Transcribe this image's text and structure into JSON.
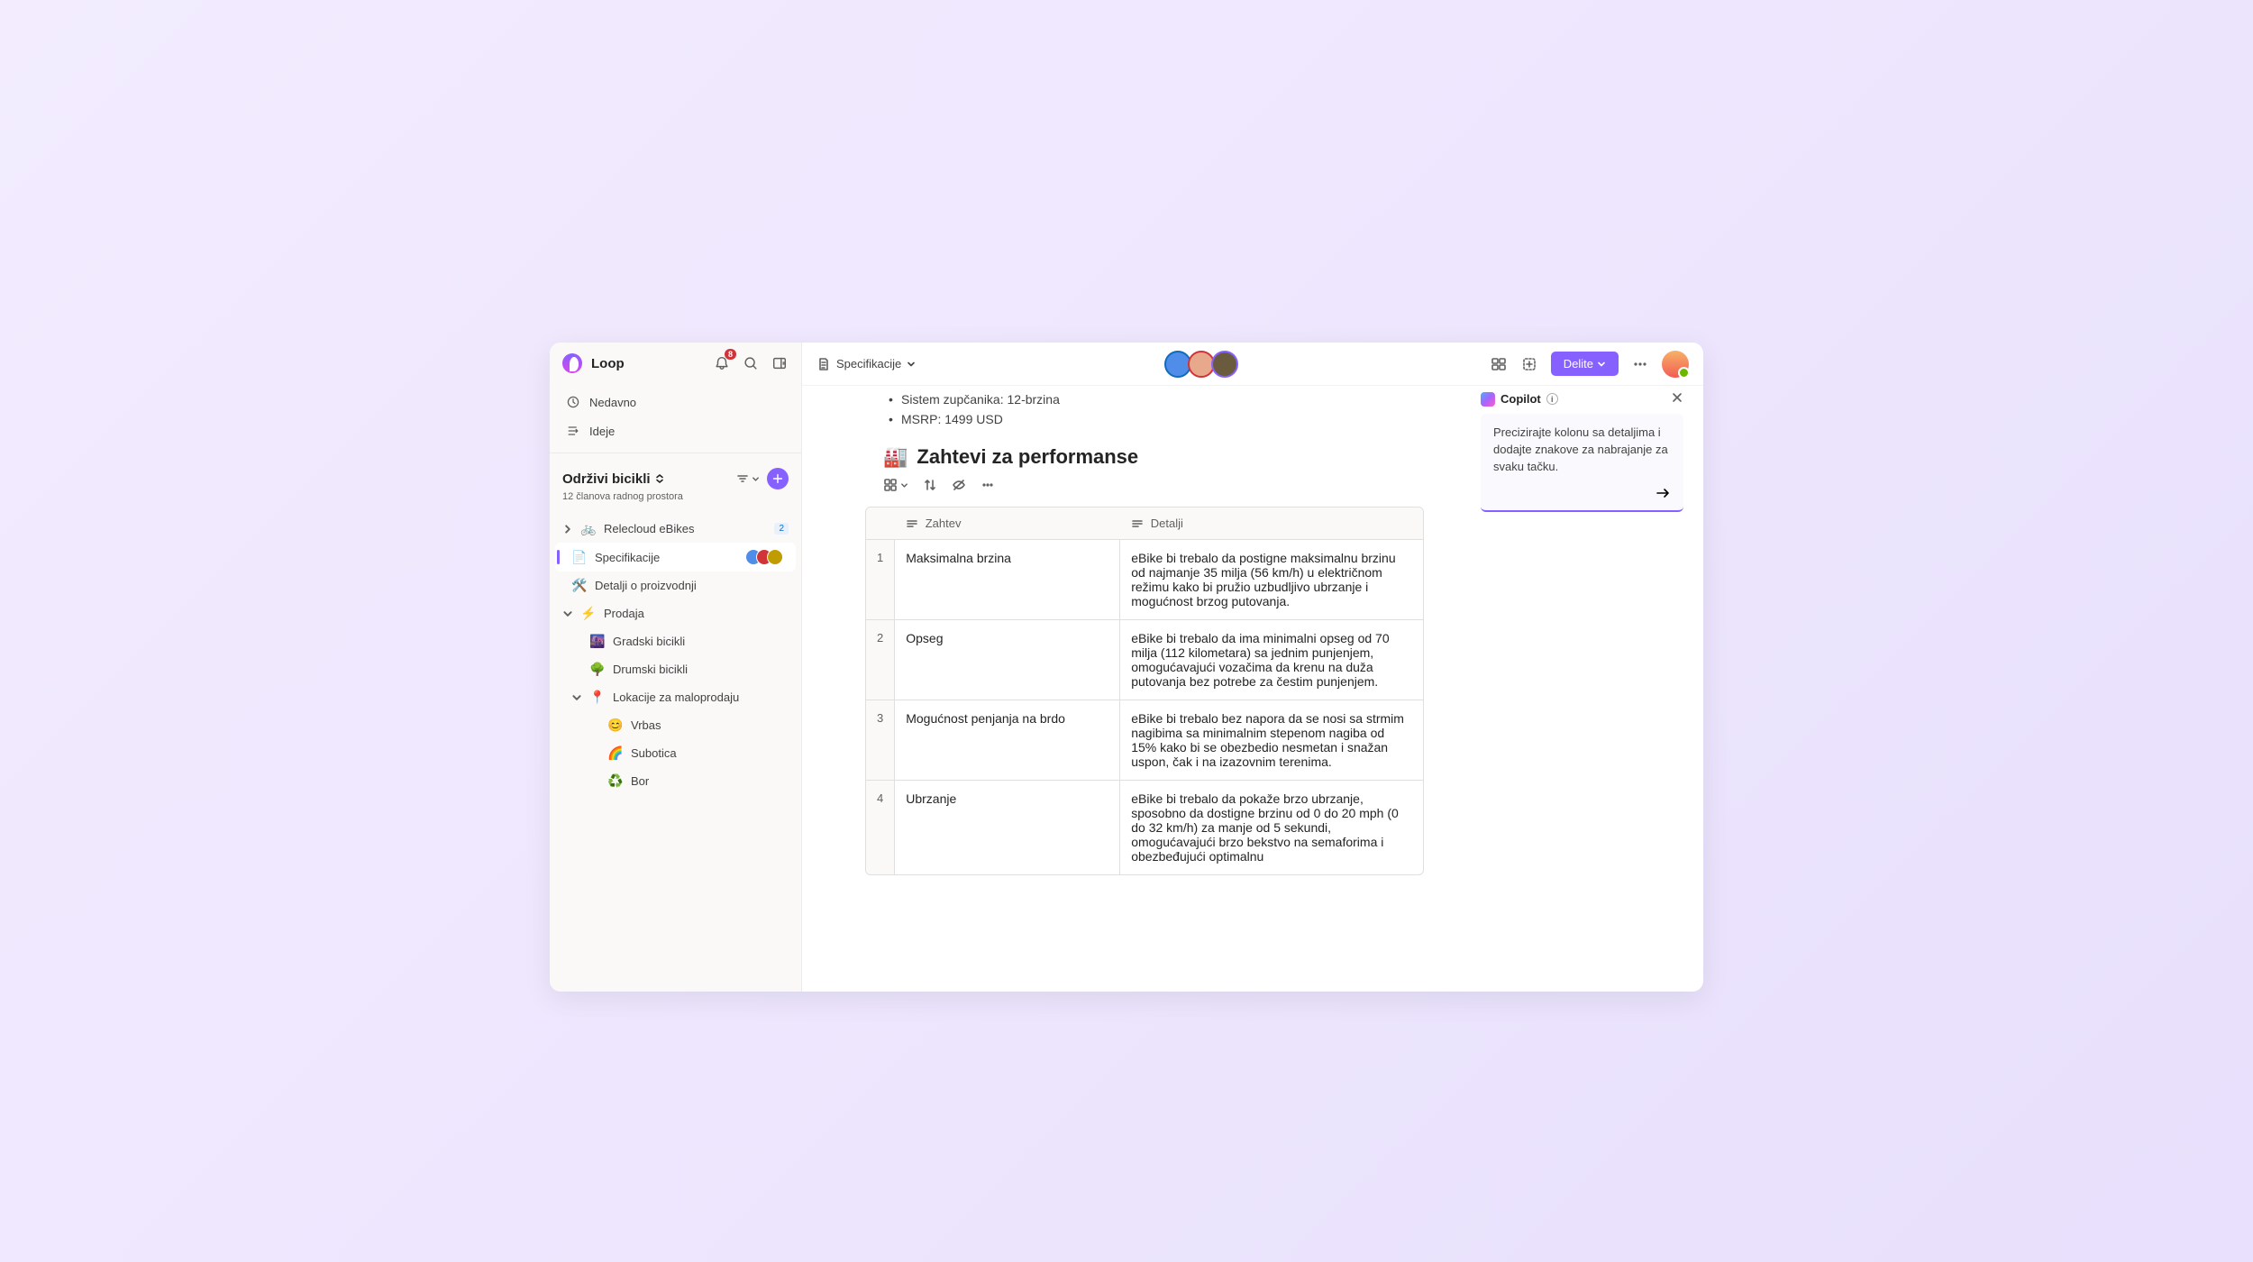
{
  "app": {
    "name": "Loop"
  },
  "sidebar": {
    "notifications_count": "8",
    "nav": {
      "recent": "Nedavno",
      "ideas": "Ideje"
    },
    "workspace": {
      "title": "Održivi bicikli",
      "subtitle": "12 članova radnog prostora"
    },
    "tree": [
      {
        "label": "Relecloud eBikes",
        "badge": "2"
      },
      {
        "label": "Specifikacije"
      },
      {
        "label": "Detalji o proizvodnji"
      },
      {
        "label": "Prodaja"
      },
      {
        "label": "Gradski bicikli"
      },
      {
        "label": "Drumski bicikli"
      },
      {
        "label": "Lokacije za maloprodaju"
      },
      {
        "label": "Vrbas"
      },
      {
        "label": "Subotica"
      },
      {
        "label": "Bor"
      }
    ]
  },
  "topbar": {
    "breadcrumb": "Specifikacije",
    "share": "Delite"
  },
  "doc": {
    "bullets": [
      "Sistem zupčanika: 12-brzina",
      "MSRP: 1499 USD"
    ],
    "heading": "Zahtevi za performanse",
    "heading_emoji": "🏭",
    "columns": {
      "req": "Zahtev",
      "det": "Detalji"
    },
    "rows": [
      {
        "n": "1",
        "req": "Maksimalna brzina",
        "det": "eBike bi trebalo da postigne maksimalnu brzinu od najmanje 35 milja (56 km/h) u električnom režimu kako bi pružio uzbudljivo ubrzanje i mogućnost brzog putovanja."
      },
      {
        "n": "2",
        "req": "Opseg",
        "det": "eBike bi trebalo da ima minimalni opseg od 70 milja (112 kilometara) sa jednim punjenjem, omogućavajući vozačima da krenu na duža putovanja bez potrebe za čestim punjenjem."
      },
      {
        "n": "3",
        "req": "Mogućnost penjanja na brdo",
        "det": "eBike bi trebalo bez napora da se nosi sa strmim nagibima sa minimalnim stepenom nagiba od 15% kako bi se obezbedio nesmetan i snažan uspon, čak i na izazovnim terenima."
      },
      {
        "n": "4",
        "req": "Ubrzanje",
        "det": "eBike bi trebalo da pokaže brzo ubrzanje, sposobno da dostigne brzinu od 0 do 20 mph (0 do 32 km/h) za manje od 5 sekundi, omogućavajući brzo bekstvo na semaforima i obezbeđujući optimalnu"
      }
    ]
  },
  "copilot": {
    "title": "Copilot",
    "prompt": "Precizirajte kolonu sa detaljima i dodajte znakove za nabrajanje za svaku tačku."
  }
}
